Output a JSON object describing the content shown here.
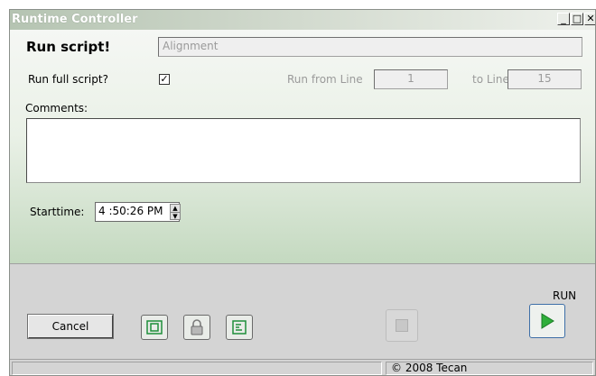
{
  "window": {
    "title": "Runtime Controller",
    "controls": [
      "minimize",
      "maximize",
      "close"
    ]
  },
  "form": {
    "run_script_label": "Run script!",
    "script_name": "Alignment",
    "run_full_label": "Run full script?",
    "run_full_checked": true,
    "run_from_label": "Run from Line",
    "run_from_value": "1",
    "to_line_label": "to Line",
    "to_line_value": "15",
    "comments_label": "Comments:",
    "comments_value": "",
    "starttime_label": "Starttime:",
    "starttime_value": "4 :50:26 PM"
  },
  "bottom": {
    "cancel_label": "Cancel",
    "run_label": "RUN",
    "icons": [
      "fit-view-icon",
      "lock-icon",
      "script-list-icon"
    ]
  },
  "status": {
    "left": "",
    "right": "© 2008 Tecan"
  },
  "colors": {
    "run_green": "#2fae3a",
    "icon_green": "#1f8f3a"
  }
}
